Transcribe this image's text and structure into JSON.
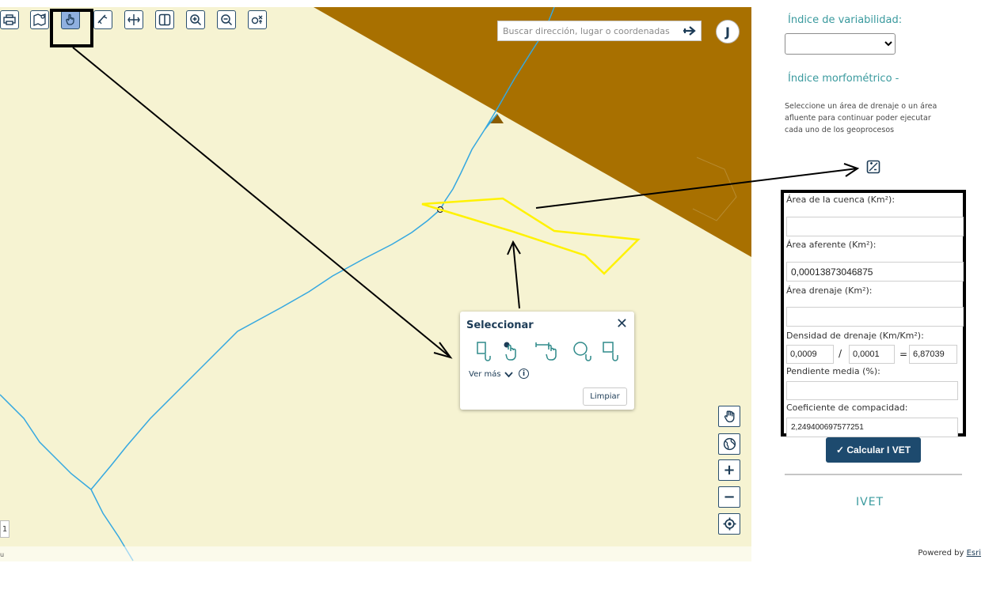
{
  "toolbar": {
    "tools": [
      {
        "name": "print-icon",
        "active": false
      },
      {
        "name": "map-layers-icon",
        "active": false
      },
      {
        "name": "select-hand-icon",
        "active": true
      },
      {
        "name": "measure-icon",
        "active": false
      },
      {
        "name": "pan-arrows-icon",
        "active": false
      },
      {
        "name": "swipe-compare-icon",
        "active": false
      },
      {
        "name": "zoom-in-icon",
        "active": false
      },
      {
        "name": "zoom-out-icon",
        "active": false
      },
      {
        "name": "coordinates-icon",
        "active": false
      }
    ]
  },
  "search": {
    "placeholder": "Buscar dirección, lugar o coordenadas"
  },
  "user": {
    "initial": "J"
  },
  "select_popup": {
    "title": "Seleccionar",
    "tools": [
      "select-rectangle-icon",
      "select-point-icon",
      "select-line-icon",
      "select-circle-icon",
      "select-polygon-icon"
    ],
    "more_label": "Ver más",
    "clear_label": "Limpiar"
  },
  "map_controls": [
    "pan-hand-icon",
    "globe-icon",
    "+",
    "−",
    "locate-icon"
  ],
  "map_footer": {
    "scale_label": "1",
    "attribution_prefix": "Powered by",
    "attribution_link": "Esri"
  },
  "colors": {
    "map_bg": "#f6f3d2",
    "terrain": "#a87000",
    "streams": "#35a8e0",
    "selection": "#fff200",
    "brand": "#1d4a6e",
    "accent": "#3a9a9e"
  },
  "panel": {
    "variability_label": "Índice de variabilidad:",
    "variability_value": "",
    "morpho_label": "Índice morfométrico -",
    "help_text": "Seleccione un área de drenaje o un área afluente para continuar poder ejecutar cada uno de los geoprocesos",
    "calc_icon": "calculator-icon",
    "fields": {
      "cuenca_label": "Área de la cuenca (Km²):",
      "cuenca_value": "",
      "aferente_label": "Área aferente (Km²):",
      "aferente_value": "0,00013873046875",
      "drenaje_label": "Área drenaje (Km²):",
      "drenaje_value": "",
      "densidad_label": "Densidad de drenaje (Km/Km²):",
      "densidad_a": "0,0009",
      "densidad_b": "0,0001",
      "densidad_result": "6,87039",
      "div_op": "/",
      "eq_op": "=",
      "pendiente_label": "Pendiente media (%):",
      "pendiente_value": "",
      "compacidad_label": "Coeficiente de compacidad:",
      "compacidad_value": "2,249400697577251"
    },
    "calc_button": "✓ Calcular I VET",
    "section_title": "IVET"
  }
}
